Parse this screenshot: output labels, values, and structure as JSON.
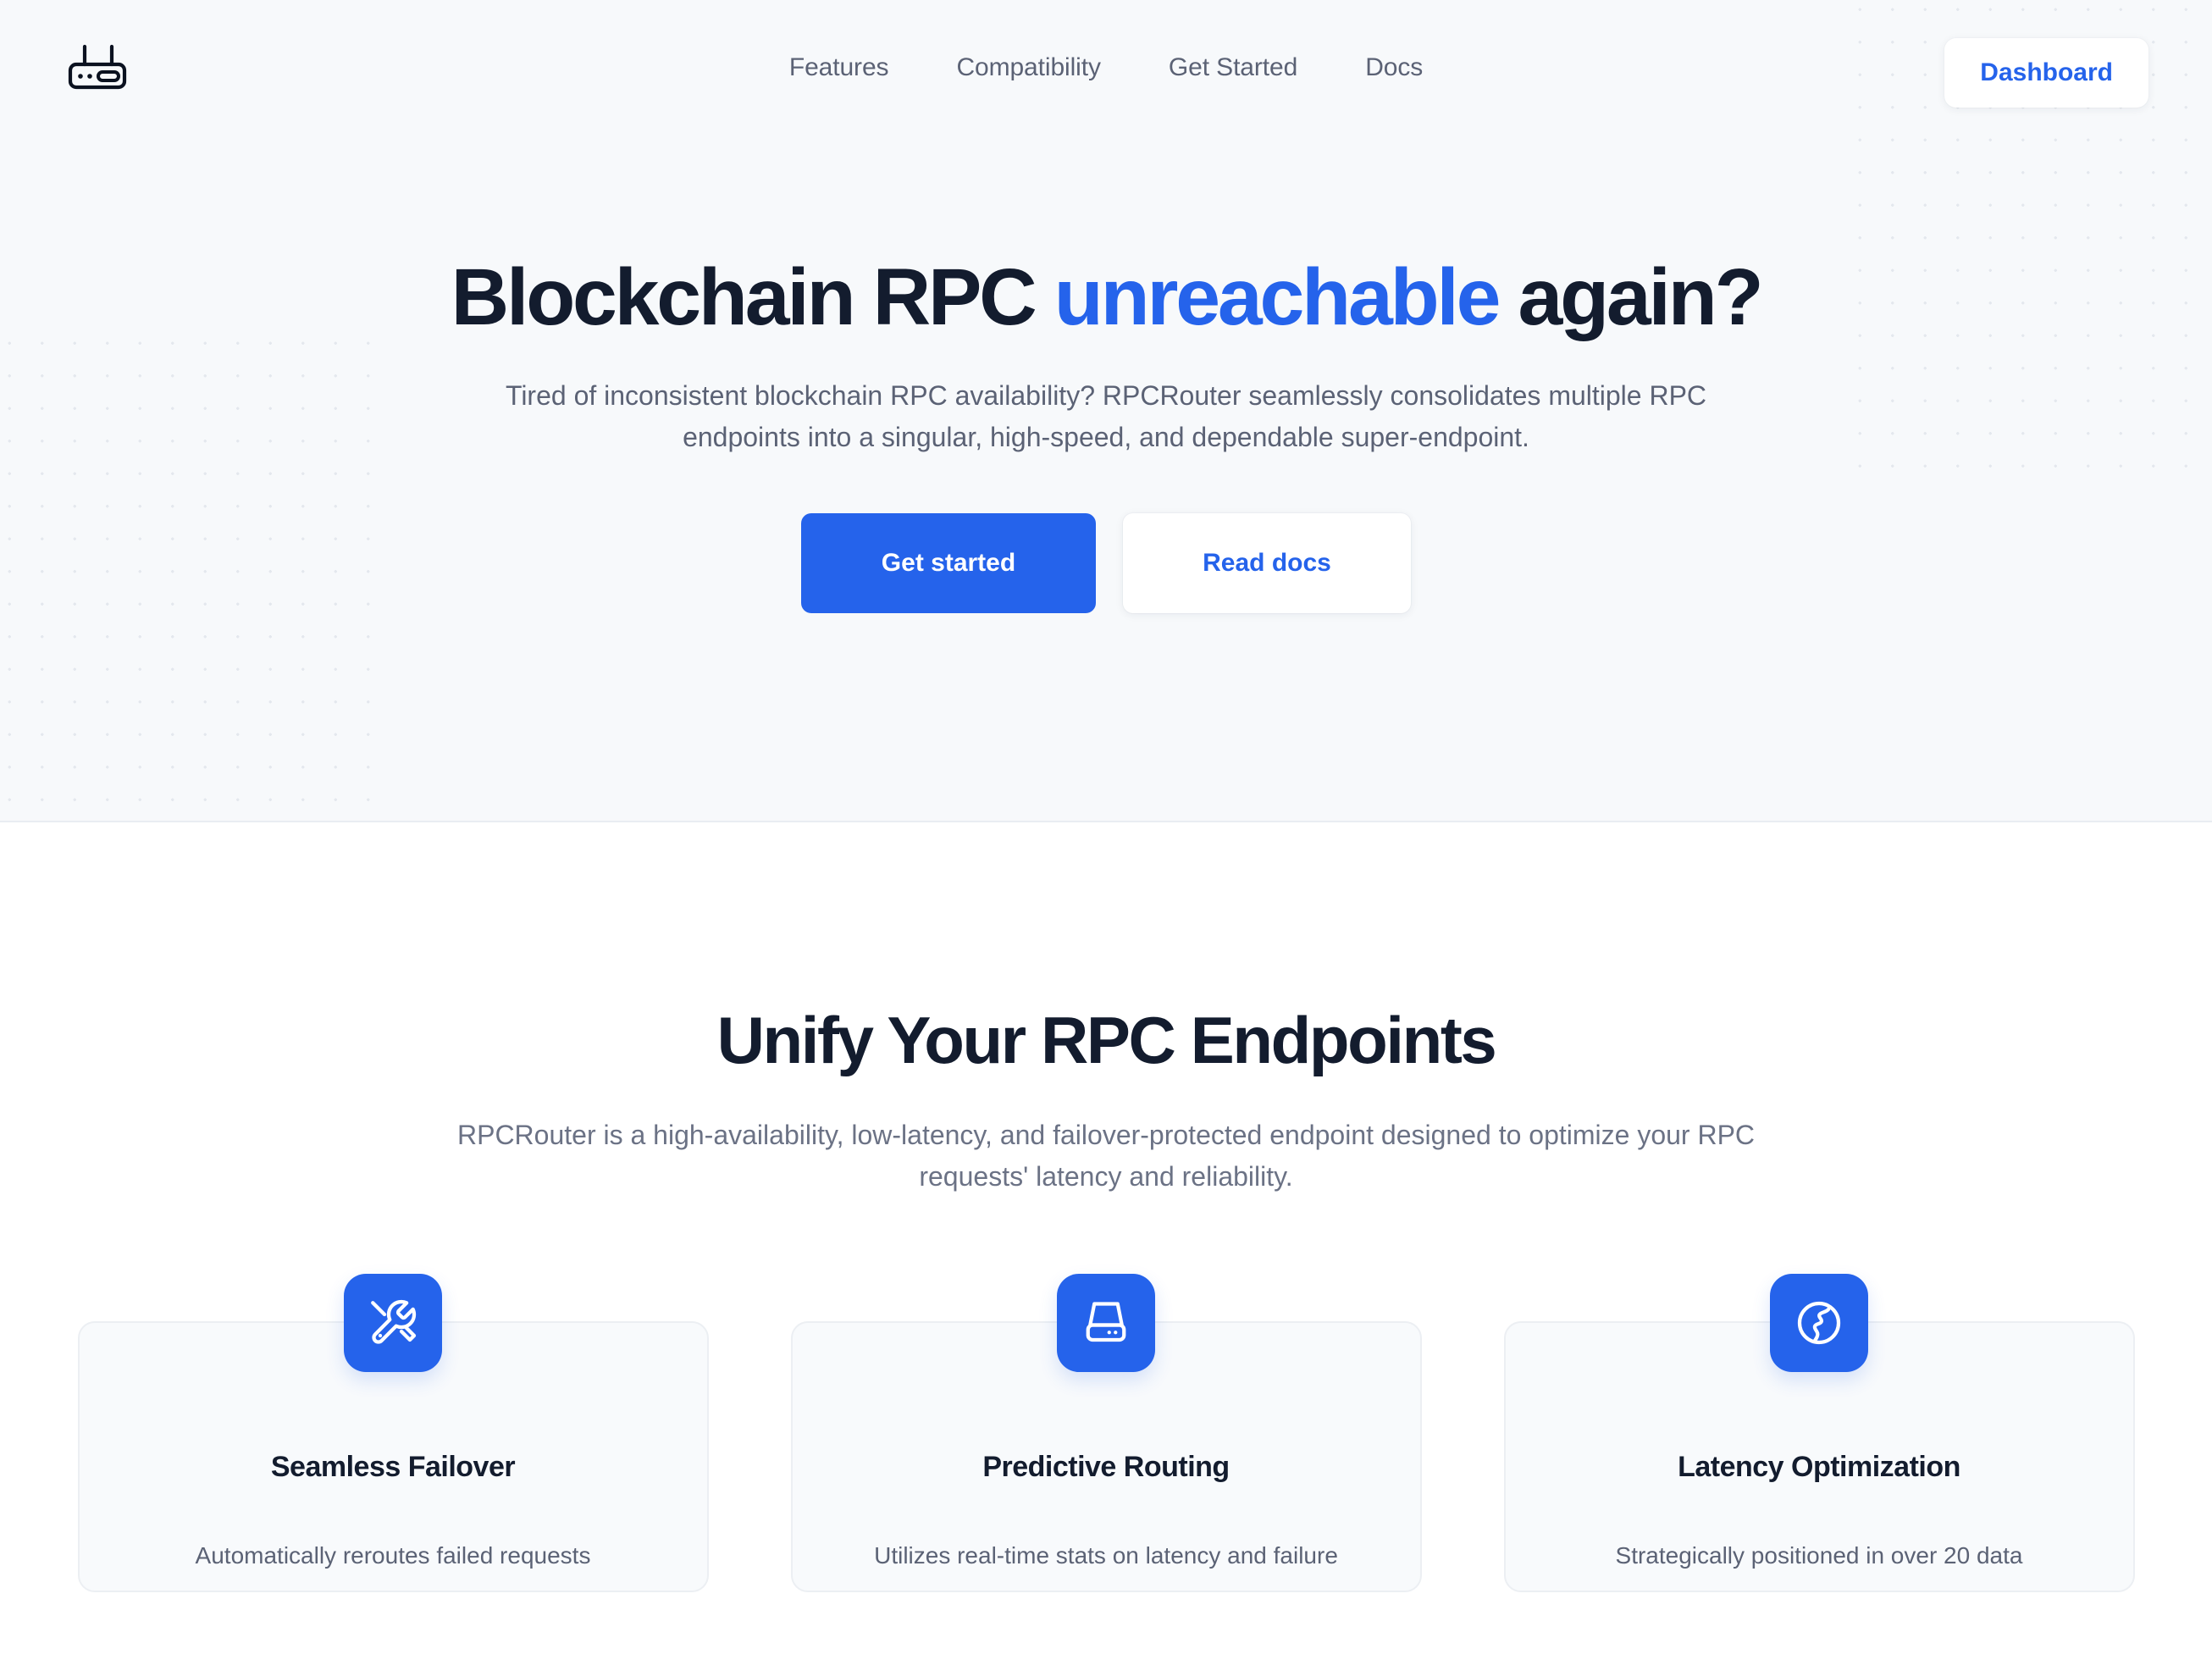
{
  "brand": {
    "logo_icon": "router-icon"
  },
  "nav": {
    "links": [
      {
        "label": "Features"
      },
      {
        "label": "Compatibility"
      },
      {
        "label": "Get Started"
      },
      {
        "label": "Docs"
      }
    ],
    "dashboard_label": "Dashboard"
  },
  "hero": {
    "title_part1": "Blockchain RPC ",
    "title_accent": "unreachable",
    "title_part2": " again?",
    "subtitle": "Tired of inconsistent blockchain RPC availability? RPCRouter seamlessly consolidates multiple RPC endpoints into a singular, high-speed, and dependable super-endpoint.",
    "primary_cta": "Get started",
    "secondary_cta": "Read docs"
  },
  "features": {
    "title": "Unify Your RPC Endpoints",
    "subtitle": "RPCRouter is a high-availability, low-latency, and failover-protected endpoint designed to optimize your RPC requests' latency and reliability.",
    "cards": [
      {
        "icon": "tools-icon",
        "title": "Seamless Failover",
        "desc": "Automatically reroutes failed requests"
      },
      {
        "icon": "server-icon",
        "title": "Predictive Routing",
        "desc": "Utilizes real-time stats on latency and failure"
      },
      {
        "icon": "globe-icon",
        "title": "Latency Optimization",
        "desc": "Strategically positioned in over 20 data"
      }
    ]
  },
  "colors": {
    "accent": "#2563eb",
    "heading": "#131c2e",
    "body_text": "#5b6275",
    "hero_bg": "#f7f9fb",
    "card_bg": "#f8fafc",
    "dot": "#e4e8ee"
  }
}
